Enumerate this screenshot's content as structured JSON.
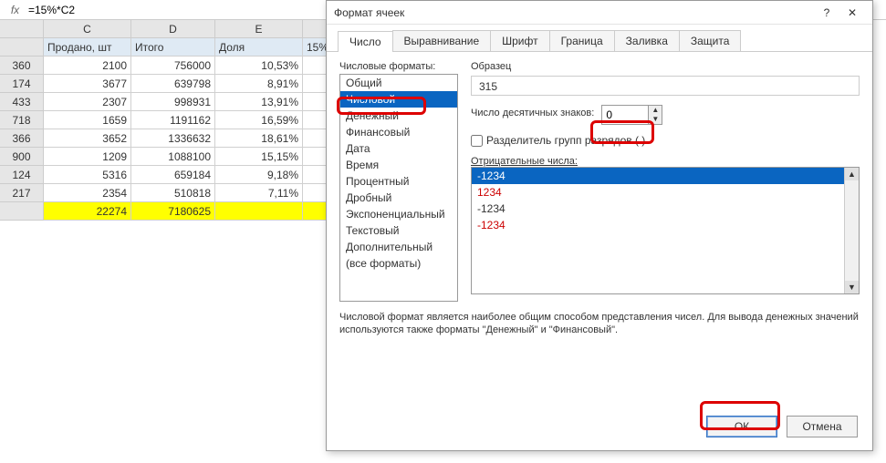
{
  "formula_bar": {
    "fx": "fx",
    "value": "=15%*C2"
  },
  "columns": [
    "C",
    "D",
    "E"
  ],
  "header_row": {
    "c": "Продано, шт",
    "d": "Итого",
    "e": "Доля",
    "f": "15%"
  },
  "rows": [
    {
      "a": "360",
      "c": "2100",
      "d": "756000",
      "e": "10,53%"
    },
    {
      "a": "174",
      "c": "3677",
      "d": "639798",
      "e": "8,91%"
    },
    {
      "a": "433",
      "c": "2307",
      "d": "998931",
      "e": "13,91%"
    },
    {
      "a": "718",
      "c": "1659",
      "d": "1191162",
      "e": "16,59%"
    },
    {
      "a": "366",
      "c": "3652",
      "d": "1336632",
      "e": "18,61%"
    },
    {
      "a": "900",
      "c": "1209",
      "d": "1088100",
      "e": "15,15%"
    },
    {
      "a": "124",
      "c": "5316",
      "d": "659184",
      "e": "9,18%"
    },
    {
      "a": "217",
      "c": "2354",
      "d": "510818",
      "e": "7,11%"
    }
  ],
  "total_row": {
    "c": "22274",
    "d": "7180625"
  },
  "dialog": {
    "title": "Формат ячеек",
    "help": "?",
    "close": "✕",
    "tabs": [
      "Число",
      "Выравнивание",
      "Шрифт",
      "Граница",
      "Заливка",
      "Защита"
    ],
    "active_tab": 0,
    "cat_label": "Числовые форматы:",
    "categories": [
      "Общий",
      "Числовой",
      "Денежный",
      "Финансовый",
      "Дата",
      "Время",
      "Процентный",
      "Дробный",
      "Экспоненциальный",
      "Текстовый",
      "Дополнительный",
      "(все форматы)"
    ],
    "selected_category": 1,
    "sample_label": "Образец",
    "sample_value": "315",
    "decimals_label": "Число десятичных знаков:",
    "decimals_value": "0",
    "separator_label": "Разделитель групп разрядов ( )",
    "neg_label": "Отрицательные числа:",
    "neg_items": [
      "-1234",
      "1234",
      "-1234",
      "-1234"
    ],
    "neg_colors": [
      "",
      "red",
      "",
      "red"
    ],
    "neg_selected": 0,
    "desc": "Числовой формат является наиболее общим способом представления чисел. Для вывода денежных значений используются также форматы \"Денежный\" и \"Финансовый\".",
    "ok": "ОК",
    "cancel": "Отмена"
  }
}
